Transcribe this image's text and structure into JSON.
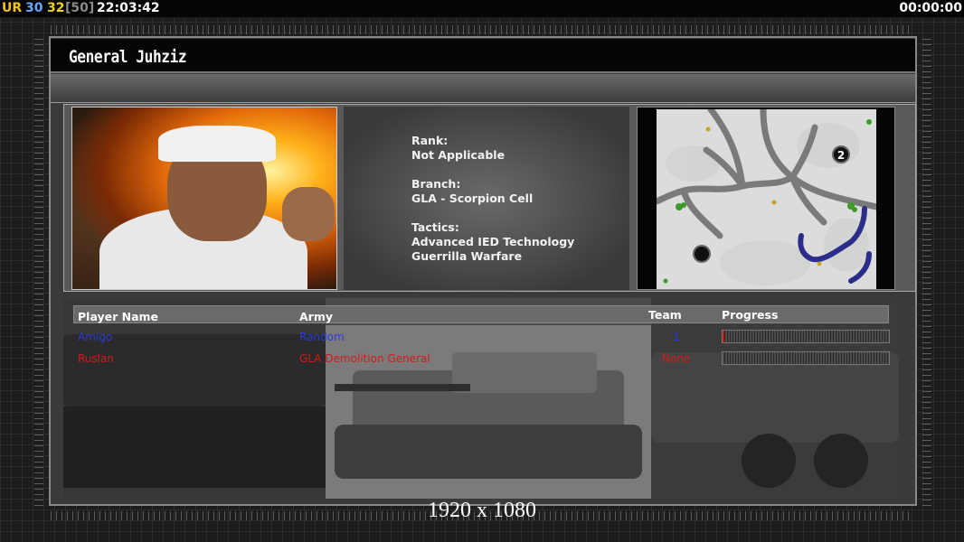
{
  "status_bar": {
    "label_ur": "UR",
    "value_a": "30",
    "value_b": "32",
    "value_c": "[50]",
    "clock": "22:03:42",
    "timer": "00:00:00"
  },
  "screen": {
    "title": "General Juhziz"
  },
  "general_info": {
    "rank_label": "Rank:",
    "rank_value": "Not Applicable",
    "branch_label": "Branch:",
    "branch_value": "GLA - Scorpion Cell",
    "tactics_label": "Tactics:",
    "tactics": [
      "Advanced IED Technology",
      "Guerrilla Warfare"
    ]
  },
  "minimap": {
    "start_marker_label": "2"
  },
  "players_table": {
    "columns": [
      "Player Name",
      "Army",
      "Team",
      "Progress"
    ],
    "rows": [
      {
        "name": "Amigo",
        "army": "Random",
        "team": "1",
        "progress": 0.01,
        "color": "#2a3ad8"
      },
      {
        "name": "Ruslan",
        "army": "GLA Demolition General",
        "team": "None",
        "progress": 0,
        "color": "#d41a1a"
      }
    ]
  },
  "overlay": {
    "resolution": "1920 x 1080"
  },
  "colors": {
    "ur": "#f0c419",
    "value_a": "#6aa7ff",
    "value_b": "#f0d21a",
    "value_c": "#8a8a8a",
    "progress": "#c01818"
  },
  "icons": [
    "star-icon",
    "tree-icon",
    "start-position-icon"
  ]
}
